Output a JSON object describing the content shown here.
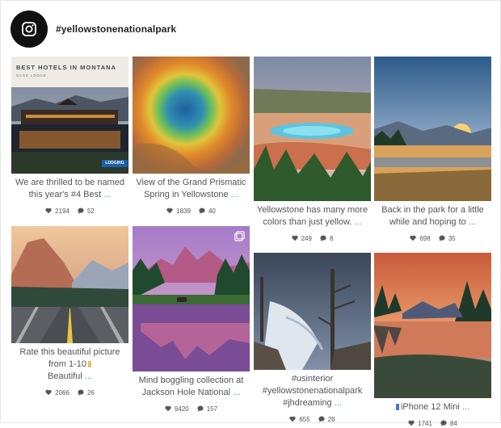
{
  "account": {
    "handle": "#yellowstonenationalpark",
    "logo_icon": "instagram-icon"
  },
  "posts": [
    {
      "caption": "We are thrilled to be named this year's #4 Best",
      "more": " ...",
      "likes": "2194",
      "comments": "52",
      "overlay_title": "BEST HOTELS IN MONTANA",
      "overlay_sub": "SAGE LODGE",
      "overlay_badge": "LODGING"
    },
    {
      "caption": "View of the Grand Prismatic Spring in Yellowstone",
      "more": " ...",
      "likes": "1839",
      "comments": "40"
    },
    {
      "caption": "Yellowstone has many more colors than just yellow.",
      "more": " ...",
      "likes": "249",
      "comments": "8"
    },
    {
      "caption": "Back in the park for a little while and hoping to",
      "more": " ...",
      "likes": "698",
      "comments": "35"
    },
    {
      "caption_line1": "Rate this beautiful picture",
      "caption_line2": "from 1-10",
      "caption_line3": "Beautiful",
      "more": " ...",
      "likes": "2066",
      "comments": "26"
    },
    {
      "caption": "Mind boggling collection at Jackson Hole National",
      "more": " ...",
      "likes": "9420",
      "comments": "157"
    },
    {
      "caption_line1": "#usinterior",
      "caption_line2": "#yellowstonenationalpark",
      "caption_line3": "#jhdreaming",
      "more": " ...",
      "likes": "655",
      "comments": "28"
    },
    {
      "caption": "iPhone 12 Mini",
      "more": " ...",
      "likes": "1741",
      "comments": "84"
    }
  ],
  "colors": {
    "link": "#2a9fd6",
    "text": "#555555",
    "logo_bg": "#111111"
  }
}
